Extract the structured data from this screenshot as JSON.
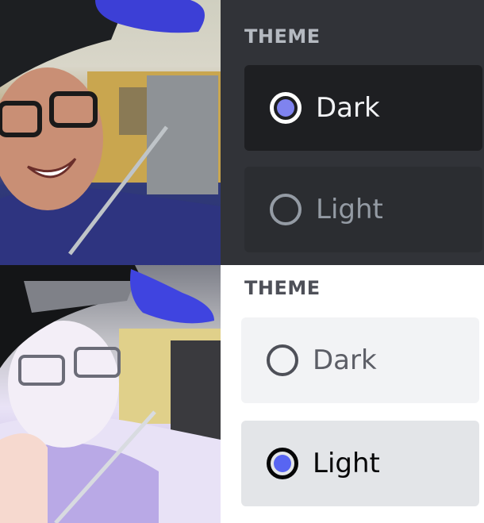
{
  "top_panel": {
    "title": "THEME",
    "options": [
      {
        "label": "Dark",
        "selected": true
      },
      {
        "label": "Light",
        "selected": false
      }
    ]
  },
  "bottom_panel": {
    "title": "THEME",
    "options": [
      {
        "label": "Dark",
        "selected": false
      },
      {
        "label": "Light",
        "selected": true
      }
    ]
  },
  "colors": {
    "dark_bg": "#313338",
    "selected_radio_dark": "#7f83ef",
    "selected_radio_light": "#5865f2"
  },
  "icons": {
    "radio_selected": "radio-selected-icon",
    "radio_unselected": "radio-unselected-icon"
  }
}
